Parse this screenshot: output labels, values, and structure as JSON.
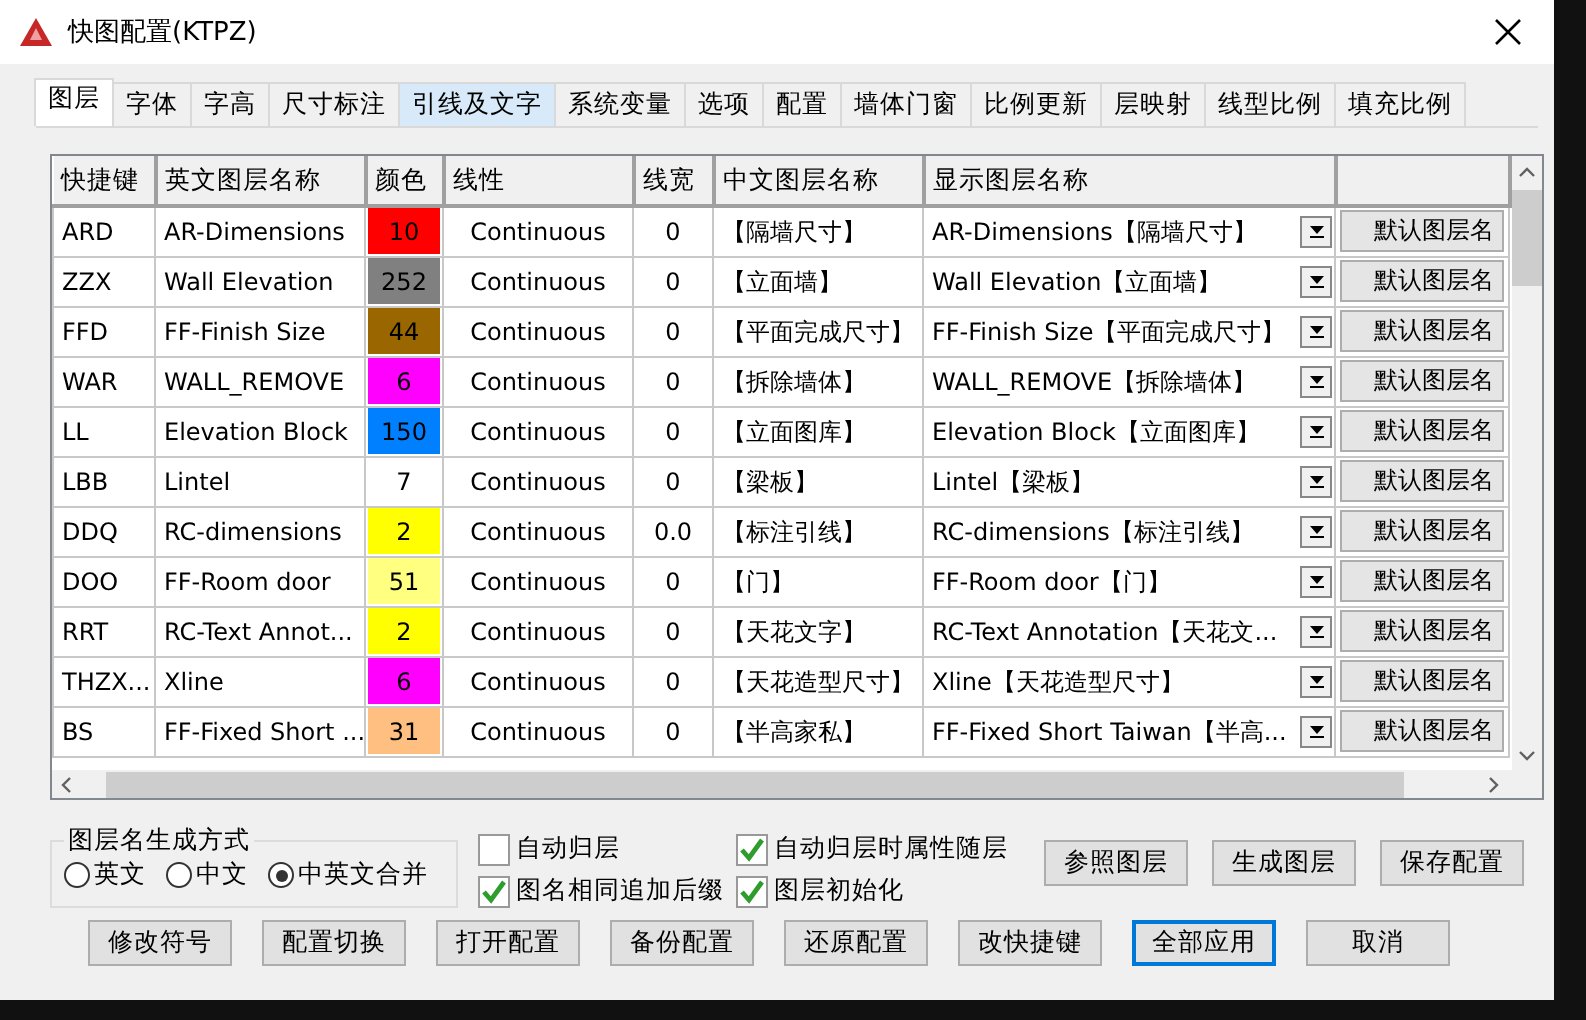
{
  "window": {
    "title": "快图配置(KTPZ)"
  },
  "tabs": [
    {
      "label": "图层",
      "selected": true,
      "hovered": false
    },
    {
      "label": "字体",
      "selected": false,
      "hovered": false
    },
    {
      "label": "字高",
      "selected": false,
      "hovered": false
    },
    {
      "label": "尺寸标注",
      "selected": false,
      "hovered": false
    },
    {
      "label": "引线及文字",
      "selected": false,
      "hovered": true
    },
    {
      "label": "系统变量",
      "selected": false,
      "hovered": false
    },
    {
      "label": "选项",
      "selected": false,
      "hovered": false
    },
    {
      "label": "配置",
      "selected": false,
      "hovered": false
    },
    {
      "label": "墙体门窗",
      "selected": false,
      "hovered": false
    },
    {
      "label": "比例更新",
      "selected": false,
      "hovered": false
    },
    {
      "label": "层映射",
      "selected": false,
      "hovered": false
    },
    {
      "label": "线型比例",
      "selected": false,
      "hovered": false
    },
    {
      "label": "填充比例",
      "selected": false,
      "hovered": false
    }
  ],
  "table": {
    "columns": [
      "快捷键",
      "英文图层名称",
      "颜色",
      "线性",
      "线宽",
      "中文图层名称",
      "显示图层名称"
    ],
    "rows": [
      {
        "shortcut": "ARD",
        "english_name": "AR-Dimensions",
        "color_index": "10",
        "color": "#ff0000",
        "linetype": "Continuous",
        "lineweight": "0",
        "chinese_name": "【隔墙尺寸】",
        "display_name": "AR-Dimensions【隔墙尺寸】",
        "button": "默认图层名"
      },
      {
        "shortcut": "ZZX",
        "english_name": "Wall Elevation",
        "color_index": "252",
        "color": "#808080",
        "linetype": "Continuous",
        "lineweight": "0",
        "chinese_name": "【立面墙】",
        "display_name": "Wall Elevation【立面墙】",
        "button": "默认图层名"
      },
      {
        "shortcut": "FFD",
        "english_name": "FF-Finish Size",
        "color_index": "44",
        "color": "#996600",
        "linetype": "Continuous",
        "lineweight": "0",
        "chinese_name": "【平面完成尺寸】",
        "display_name": "FF-Finish Size【平面完成尺寸】",
        "button": "默认图层名"
      },
      {
        "shortcut": "WAR",
        "english_name": "WALL_REMOVE",
        "color_index": "6",
        "color": "#ff00ff",
        "linetype": "Continuous",
        "lineweight": "0",
        "chinese_name": "【拆除墙体】",
        "display_name": "WALL_REMOVE【拆除墙体】",
        "button": "默认图层名"
      },
      {
        "shortcut": "LL",
        "english_name": "Elevation Block",
        "color_index": "150",
        "color": "#0080ff",
        "linetype": "Continuous",
        "lineweight": "0",
        "chinese_name": "【立面图库】",
        "display_name": "Elevation Block【立面图库】",
        "button": "默认图层名"
      },
      {
        "shortcut": "LBB",
        "english_name": "Lintel",
        "color_index": "7",
        "color": "#ffffff",
        "linetype": "Continuous",
        "lineweight": "0",
        "chinese_name": "【梁板】",
        "display_name": "Lintel【梁板】",
        "button": "默认图层名"
      },
      {
        "shortcut": "DDQ",
        "english_name": "RC-dimensions",
        "color_index": "2",
        "color": "#ffff00",
        "linetype": "Continuous",
        "lineweight": "0.0",
        "chinese_name": "【标注引线】",
        "display_name": "RC-dimensions【标注引线】",
        "button": "默认图层名"
      },
      {
        "shortcut": "DOO",
        "english_name": "FF-Room door",
        "color_index": "51",
        "color": "#ffff80",
        "linetype": "Continuous",
        "lineweight": "0",
        "chinese_name": "【门】",
        "display_name": "FF-Room door【门】",
        "button": "默认图层名"
      },
      {
        "shortcut": "RRT",
        "english_name": "RC-Text Annot...",
        "color_index": "2",
        "color": "#ffff00",
        "linetype": "Continuous",
        "lineweight": "0",
        "chinese_name": "【天花文字】",
        "display_name": "RC-Text Annotation【天花文...",
        "button": "默认图层名"
      },
      {
        "shortcut": "THZX...",
        "english_name": "Xline",
        "color_index": "6",
        "color": "#ff00ff",
        "linetype": "Continuous",
        "lineweight": "0",
        "chinese_name": "【天花造型尺寸】",
        "display_name": "Xline【天花造型尺寸】",
        "button": "默认图层名"
      },
      {
        "shortcut": "BS",
        "english_name": "FF-Fixed Short ...",
        "color_index": "31",
        "color": "#ffbf80",
        "linetype": "Continuous",
        "lineweight": "0",
        "chinese_name": "【半高家私】",
        "display_name": "FF-Fixed Short Taiwan【半高...",
        "button": "默认图层名"
      }
    ]
  },
  "name_mode": {
    "title": "图层名生成方式",
    "options": [
      {
        "label": "英文",
        "selected": false
      },
      {
        "label": "中文",
        "selected": false
      },
      {
        "label": "中英文合并",
        "selected": true
      }
    ]
  },
  "checkboxes": [
    {
      "label": "自动归层",
      "checked": false
    },
    {
      "label": "自动归层时属性随层",
      "checked": true
    },
    {
      "label": "图名相同追加后缀",
      "checked": true
    },
    {
      "label": "图层初始化",
      "checked": true
    }
  ],
  "buttons_top": [
    "参照图层",
    "生成图层",
    "保存配置"
  ],
  "buttons_bottom": [
    {
      "label": "修改符号",
      "focused": false
    },
    {
      "label": "配置切换",
      "focused": false
    },
    {
      "label": "打开配置",
      "focused": false
    },
    {
      "label": "备份配置",
      "focused": false
    },
    {
      "label": "还原配置",
      "focused": false
    },
    {
      "label": "改快捷键",
      "focused": false
    },
    {
      "label": "全部应用",
      "focused": true
    },
    {
      "label": "取消",
      "focused": false
    }
  ]
}
